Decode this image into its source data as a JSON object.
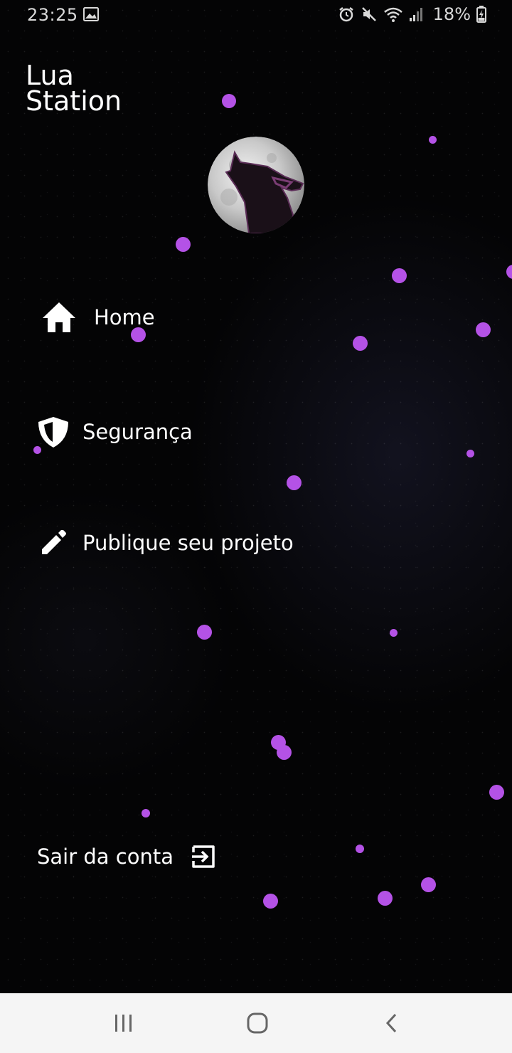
{
  "status_bar": {
    "time": "23:25",
    "battery": "18%",
    "icons": [
      "gallery-icon",
      "alarm-icon",
      "mute-icon",
      "wifi-icon",
      "signal-icon",
      "battery-charging-icon"
    ]
  },
  "app": {
    "title": "Lua\nStation",
    "avatar": "wolf-moon-logo"
  },
  "menu": {
    "items": [
      {
        "label": "Home",
        "icon": "home-icon"
      },
      {
        "label": "Segurança",
        "icon": "shield-icon"
      },
      {
        "label": "Publique seu projeto",
        "icon": "pencil-icon"
      }
    ]
  },
  "logout": {
    "label": "Sair da conta",
    "icon": "logout-icon"
  },
  "theme": {
    "background": "#040405",
    "accent": "#b452e6",
    "text": "#ffffff",
    "nav_bar": "#f5f5f5"
  },
  "nav_bar": {
    "buttons": [
      "recents-icon",
      "home-circle-icon",
      "back-icon"
    ]
  }
}
